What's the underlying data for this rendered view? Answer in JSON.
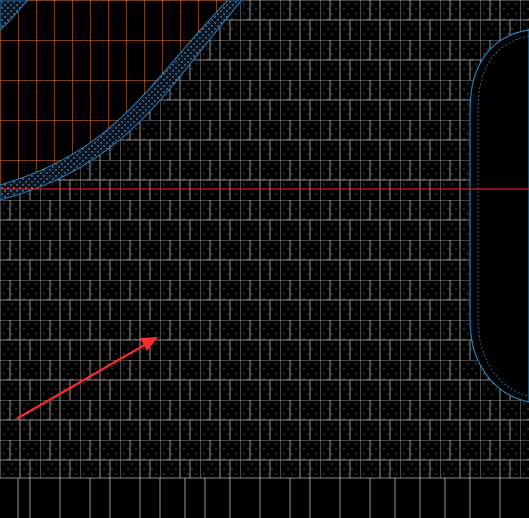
{
  "viewport": {
    "background": "#000000",
    "pattern_line_color": "#b8b8b8",
    "pattern_dot_color": "#9a9a9a",
    "border_line_color": "#2a7fbf",
    "accent_region_color": "#ff7f2a",
    "crosshair_color": "#ff2020",
    "arrow_color": "#ff2a2a"
  },
  "icons": {
    "arrow": "arrow-icon"
  }
}
